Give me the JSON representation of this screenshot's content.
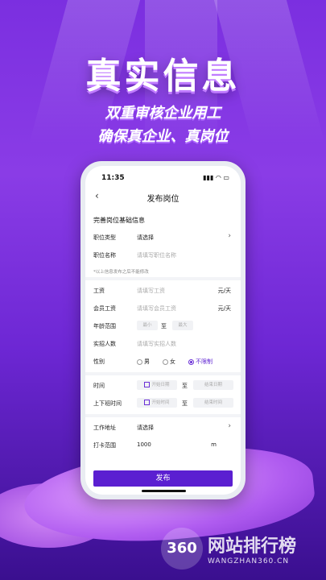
{
  "headline": "真实信息",
  "subline1": "双重审核企业用工",
  "subline2": "确保真企业、真岗位",
  "status": {
    "time": "11:35"
  },
  "nav": {
    "back": "‹",
    "title": "发布岗位"
  },
  "section_title": "完善岗位基础信息",
  "fields": {
    "job_type": {
      "label": "职位类型",
      "value": "请选择"
    },
    "job_name": {
      "label": "职位名称",
      "placeholder": "请填写职位名称"
    },
    "hint": "*以上信息发布之后不能修改",
    "salary": {
      "label": "工资",
      "placeholder": "请填写工资",
      "unit": "元/天"
    },
    "member_salary": {
      "label": "会员工资",
      "placeholder": "请填写会员工资",
      "unit": "元/天"
    },
    "age": {
      "label": "年龄范围",
      "min": "最小",
      "to": "至",
      "max": "最大"
    },
    "headcount": {
      "label": "实招人数",
      "placeholder": "请填写实招人数"
    },
    "gender": {
      "label": "性别",
      "options": [
        "男",
        "女",
        "不限制"
      ],
      "selected": "不限制"
    },
    "time": {
      "label": "时间",
      "start": "开始日期",
      "to": "至",
      "end": "结束日期"
    },
    "work_hours": {
      "label": "上下班时间",
      "start": "开始时间",
      "to": "至",
      "end": "结束时间"
    },
    "address": {
      "label": "工作地址",
      "value": "请选择"
    },
    "clock_range": {
      "label": "打卡范围",
      "value": "1000",
      "unit": "m"
    }
  },
  "submit": "发布",
  "watermark": {
    "logo": "360",
    "cn": "网站排行榜",
    "en": "WANGZHAN360.CN"
  },
  "colors": {
    "accent": "#5b1fd1",
    "bg": "#7b2fe0"
  }
}
